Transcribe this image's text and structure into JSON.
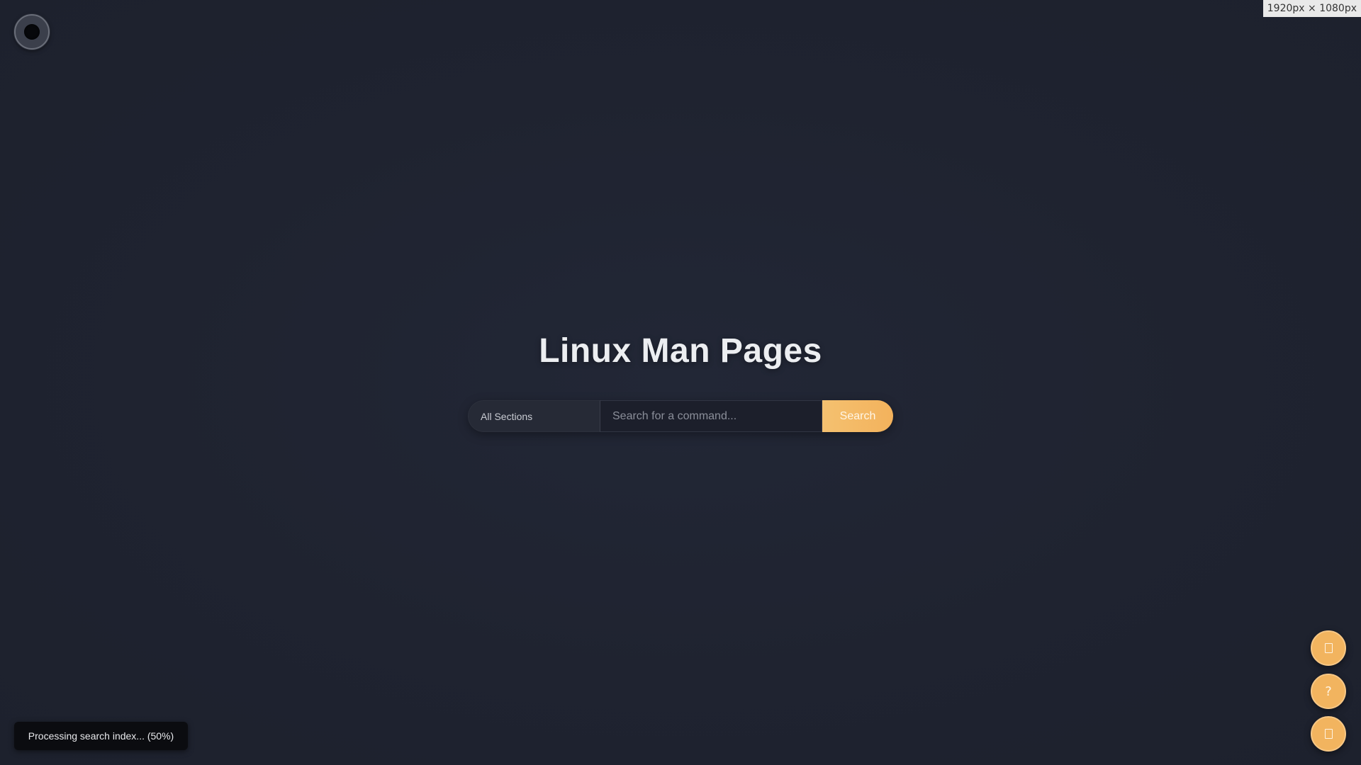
{
  "viewport_badge": "1920px × 1080px",
  "header": {
    "title": "Linux Man Pages"
  },
  "search": {
    "section_label": "All Sections",
    "placeholder": "Search for a command...",
    "value": "",
    "button_label": "Search"
  },
  "floating_actions": {
    "top_icon": "square-icon",
    "help_label": "?",
    "bottom_icon": "square-icon"
  },
  "status": {
    "message": "Processing search index... (50%)",
    "progress": 0.5
  },
  "colors": {
    "background": "#1f2330",
    "accent": "#f2b45f",
    "title": "#eceef1"
  },
  "theme_toggle": {
    "icon": "dark-mode-icon"
  }
}
